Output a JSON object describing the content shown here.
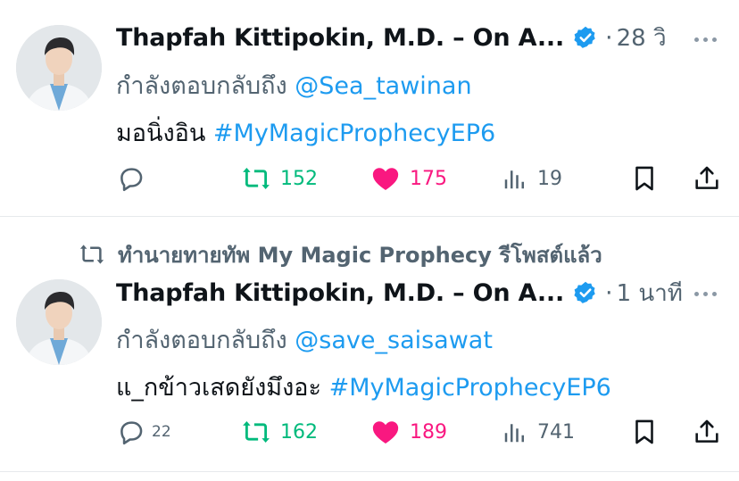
{
  "colors": {
    "accent": "#1d9bf0",
    "retweet": "#00ba7c",
    "like": "#f91880",
    "muted": "#536471",
    "text": "#0f1419"
  },
  "tweets": [
    {
      "author": "Thapfah Kittipokin, M.D. – On A...",
      "verified": true,
      "time": "28 วิ",
      "replying_label": "กำลังตอบกลับถึง",
      "replying_to": "@Sea_tawinan",
      "text": "มอนิ่งอิน",
      "hashtag": "#MyMagicProphecyEP6",
      "reply_count": "",
      "retweets": "152",
      "likes": "175",
      "views": "19"
    },
    {
      "reposted_by": "ทำนายทายทัพ My Magic Prophecy รีโพสต์แล้ว",
      "author": "Thapfah Kittipokin, M.D. – On A...",
      "verified": true,
      "time": "1 นาที",
      "replying_label": "กำลังตอบกลับถึง",
      "replying_to": "@save_saisawat",
      "text": "แ_กข้าวเสดยังมึงอะ",
      "hashtag": "#MyMagicProphecyEP6",
      "reply_count": "22",
      "retweets": "162",
      "likes": "189",
      "views": "741"
    }
  ],
  "icons": {
    "reply": "speech-bubble-icon",
    "retweet": "repost-arrows-icon",
    "like": "heart-icon",
    "views": "bar-chart-icon",
    "bookmark": "bookmark-icon",
    "share": "share-upload-icon",
    "more": "more-dots-icon",
    "verified": "verified-badge-icon"
  }
}
